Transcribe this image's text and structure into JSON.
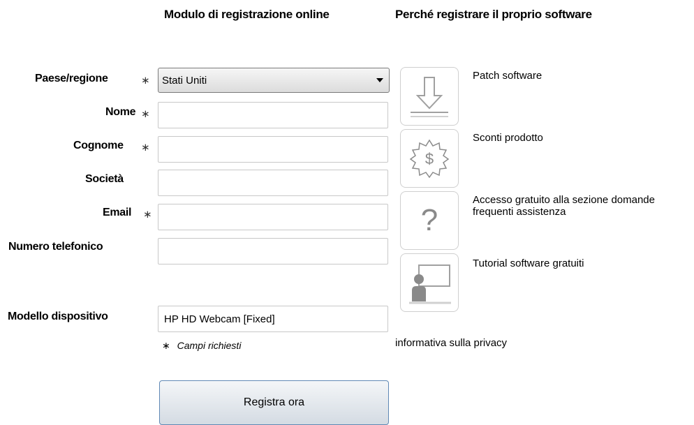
{
  "form": {
    "heading": "Modulo di registrazione online",
    "required_marker": "∗",
    "fields": {
      "country": {
        "label": "Paese/regione",
        "value": "Stati Uniti"
      },
      "first_name": {
        "label": "Nome",
        "value": ""
      },
      "last_name": {
        "label": "Cognome",
        "value": ""
      },
      "company": {
        "label": "Società",
        "value": ""
      },
      "email": {
        "label": "Email",
        "value": ""
      },
      "phone": {
        "label": "Numero telefonico",
        "value": ""
      },
      "device_model": {
        "label": "Modello dispositivo",
        "value": "HP HD Webcam [Fixed]"
      }
    },
    "required_note": "Campi richiesti",
    "submit_label": "Registra ora"
  },
  "benefits": {
    "heading": "Perché registrare il proprio software",
    "items": [
      {
        "icon": "download-arrow-icon",
        "text": "Patch software"
      },
      {
        "icon": "dollar-badge-icon",
        "text": "Sconti prodotto"
      },
      {
        "icon": "question-mark-icon",
        "text": "Accesso gratuito alla sezione domande frequenti  assistenza"
      },
      {
        "icon": "tutorial-presenter-icon",
        "text": "Tutorial software gratuiti"
      }
    ],
    "privacy_link": "informativa sulla privacy"
  },
  "colors": {
    "button_border": "#5f88b5",
    "icon_gray": "#a0a0a0",
    "field_border": "#c8c8c8"
  }
}
